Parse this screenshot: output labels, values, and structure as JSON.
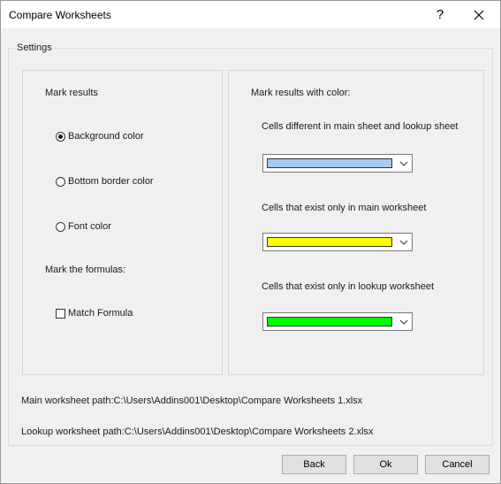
{
  "window": {
    "title": "Compare Worksheets",
    "help_label": "?"
  },
  "settings": {
    "legend": "Settings",
    "mark_results": {
      "heading": "Mark results",
      "options": [
        {
          "label": "Background color",
          "selected": true
        },
        {
          "label": "Bottom border color",
          "selected": false
        },
        {
          "label": "Font color",
          "selected": false
        }
      ]
    },
    "mark_formulas": {
      "heading": "Mark the formulas:",
      "checkbox_label": "Match Formula",
      "checked": false
    },
    "mark_color": {
      "heading": "Mark results with color:",
      "items": [
        {
          "label": "Cells different in main sheet and lookup sheet",
          "color": "#a6caf0"
        },
        {
          "label": "Cells that exist only in main worksheet",
          "color": "#ffff00"
        },
        {
          "label": "Cells that exist only in lookup worksheet",
          "color": "#00ff00"
        }
      ]
    }
  },
  "paths": {
    "main": "Main worksheet path:C:\\Users\\Addins001\\Desktop\\Compare Worksheets 1.xlsx",
    "lookup": "Lookup worksheet path:C:\\Users\\Addins001\\Desktop\\Compare Worksheets 2.xlsx"
  },
  "buttons": {
    "back": "Back",
    "ok": "Ok",
    "cancel": "Cancel"
  }
}
